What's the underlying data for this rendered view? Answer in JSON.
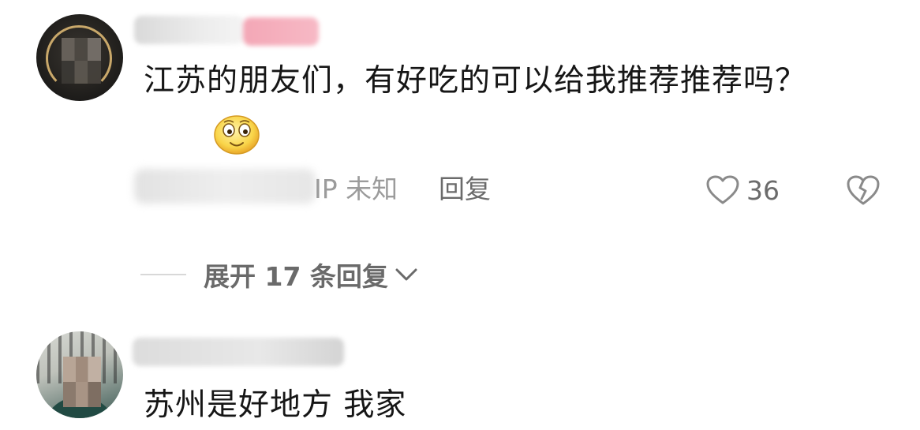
{
  "comments": [
    {
      "text": "江苏的朋友们，有好吃的可以给我推荐推荐吗？",
      "emoji": "smiling-face-emoji",
      "ip_label": "IP 未知",
      "reply_label": "回复",
      "like_count": "36",
      "expand_replies_label": "展开 17 条回复"
    },
    {
      "text": "苏州是好地方 我家"
    }
  ],
  "colors": {
    "text_primary": "#161616",
    "text_secondary": "#9b9b9b",
    "action_gray": "#6b6b6b",
    "divider": "#d8d8d8"
  },
  "icons": {
    "like": "heart-outline-icon",
    "dislike": "broken-heart-icon",
    "expand": "chevron-down-icon"
  }
}
